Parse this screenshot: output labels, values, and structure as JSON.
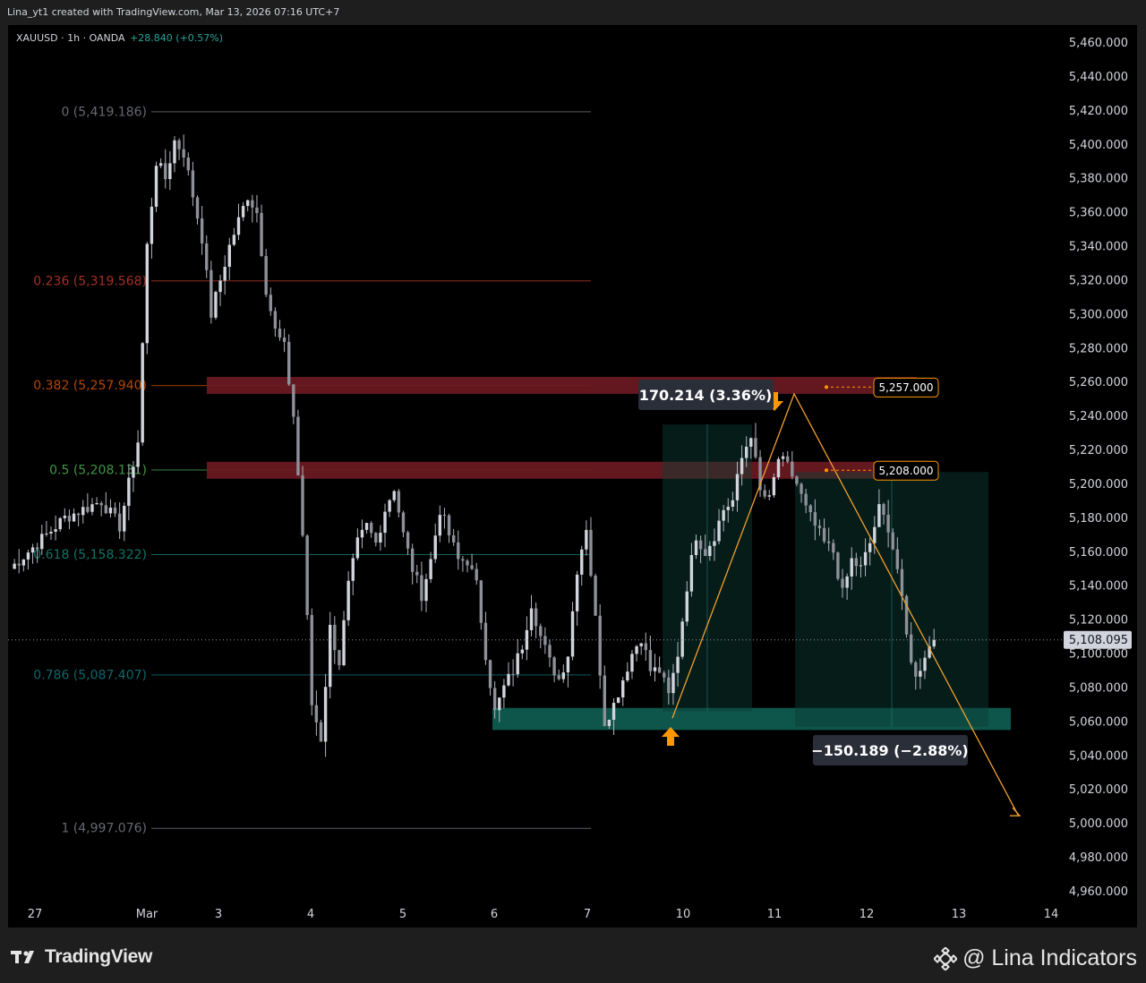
{
  "header": {
    "credit": "Lina_yt1 created with TradingView.com, Mar 13, 2026 07:16 UTC+7",
    "symbol": "XAUUSD · 1h · OANDA",
    "change": "+28.840 (+0.57%)"
  },
  "footer": {
    "logo_text": "TradingView",
    "watermark": "@ Lina Indicators"
  },
  "colors": {
    "background": "#000000",
    "candle": "#b2b5be",
    "support_zone": "#0f5c52",
    "resistance_zone": "#6b1a22",
    "projection_line": "#f0a030",
    "arrow": "#ff9800"
  },
  "chart_data": {
    "type": "candlestick",
    "symbol": "XAUUSD",
    "timeframe": "1h",
    "ylim": [
      4950,
      5470
    ],
    "y_ticks": [
      "5,460.000",
      "5,440.000",
      "5,420.000",
      "5,400.000",
      "5,380.000",
      "5,360.000",
      "5,340.000",
      "5,320.000",
      "5,300.000",
      "5,280.000",
      "5,260.000",
      "5,240.000",
      "5,220.000",
      "5,200.000",
      "5,180.000",
      "5,160.000",
      "5,140.000",
      "5,120.000",
      "5,100.000",
      "5,080.000",
      "5,060.000",
      "5,040.000",
      "5,020.000",
      "5,000.000",
      "4,980.000",
      "4,960.000"
    ],
    "x_ticks": [
      "27",
      "Mar",
      "3",
      "4",
      "5",
      "6",
      "7",
      "10",
      "11",
      "12",
      "13",
      "14"
    ],
    "current_price": "5,108.095",
    "fibonacci": [
      {
        "label": "0 (5,419.186)",
        "price": 5419.186,
        "color": "#787b86"
      },
      {
        "label": "0.236 (5,319.568)",
        "price": 5319.568,
        "color": "#c0392b"
      },
      {
        "label": "0.382 (5,257.940)",
        "price": 5257.94,
        "color": "#d35400"
      },
      {
        "label": "0.5 (5,208.131)",
        "price": 5208.131,
        "color": "#4caf50"
      },
      {
        "label": "0.618 (5,158.322)",
        "price": 5158.322,
        "color": "#13897a"
      },
      {
        "label": "0.786 (5,087.407)",
        "price": 5087.407,
        "color": "#0e7a80"
      },
      {
        "label": "1 (4,997.076)",
        "price": 4997.076,
        "color": "#787b86"
      }
    ],
    "zones": [
      {
        "name": "resistance",
        "low": 5253,
        "high": 5263
      },
      {
        "name": "resistance",
        "low": 5203,
        "high": 5213
      },
      {
        "name": "support",
        "low": 5055,
        "high": 5068
      }
    ],
    "level_tags": [
      "5,257.000",
      "5,208.000"
    ],
    "measure_up": "170.214 (3.36%)",
    "measure_down": "−150.189 (−2.88%)",
    "close_anchors": [
      [
        0,
        5150
      ],
      [
        6,
        5180
      ],
      [
        10,
        5190
      ],
      [
        12,
        5175
      ],
      [
        14,
        5225
      ],
      [
        15,
        5340
      ],
      [
        16,
        5390
      ],
      [
        17,
        5380
      ],
      [
        18,
        5402
      ],
      [
        19,
        5395
      ],
      [
        21,
        5345
      ],
      [
        22,
        5300
      ],
      [
        23,
        5320
      ],
      [
        24,
        5340
      ],
      [
        25,
        5355
      ],
      [
        26,
        5370
      ],
      [
        27,
        5360
      ],
      [
        28,
        5315
      ],
      [
        29,
        5290
      ],
      [
        30,
        5280
      ],
      [
        31,
        5240
      ],
      [
        32,
        5170
      ],
      [
        33,
        5070
      ],
      [
        34,
        5050
      ],
      [
        35,
        5115
      ],
      [
        36,
        5095
      ],
      [
        37,
        5140
      ],
      [
        38,
        5165
      ],
      [
        39,
        5175
      ],
      [
        40,
        5165
      ],
      [
        41,
        5185
      ],
      [
        42,
        5198
      ],
      [
        43,
        5170
      ],
      [
        44,
        5150
      ],
      [
        45,
        5135
      ],
      [
        46,
        5155
      ],
      [
        47,
        5185
      ],
      [
        48,
        5170
      ],
      [
        49,
        5155
      ],
      [
        50,
        5155
      ],
      [
        51,
        5140
      ],
      [
        52,
        5100
      ],
      [
        53,
        5065
      ],
      [
        54,
        5080
      ],
      [
        55,
        5090
      ],
      [
        56,
        5105
      ],
      [
        57,
        5130
      ],
      [
        58,
        5110
      ],
      [
        59,
        5095
      ],
      [
        60,
        5085
      ],
      [
        61,
        5100
      ],
      [
        62,
        5150
      ],
      [
        63,
        5175
      ],
      [
        64,
        5120
      ],
      [
        65,
        5060
      ],
      [
        66,
        5070
      ],
      [
        67,
        5085
      ],
      [
        68,
        5100
      ],
      [
        69,
        5110
      ],
      [
        70,
        5090
      ],
      [
        71,
        5090
      ],
      [
        72,
        5075
      ],
      [
        73,
        5100
      ],
      [
        74,
        5140
      ],
      [
        75,
        5170
      ],
      [
        76,
        5160
      ],
      [
        77,
        5170
      ],
      [
        78,
        5185
      ],
      [
        79,
        5190
      ],
      [
        80,
        5215
      ],
      [
        81,
        5230
      ],
      [
        82,
        5195
      ],
      [
        83,
        5190
      ],
      [
        84,
        5215
      ],
      [
        85,
        5210
      ],
      [
        86,
        5200
      ],
      [
        87,
        5185
      ],
      [
        88,
        5175
      ],
      [
        89,
        5165
      ],
      [
        90,
        5160
      ],
      [
        91,
        5135
      ],
      [
        92,
        5155
      ],
      [
        93,
        5150
      ],
      [
        94,
        5165
      ],
      [
        95,
        5185
      ],
      [
        96,
        5175
      ],
      [
        97,
        5150
      ],
      [
        98,
        5110
      ],
      [
        99,
        5085
      ],
      [
        100,
        5100
      ],
      [
        101,
        5108
      ]
    ]
  }
}
